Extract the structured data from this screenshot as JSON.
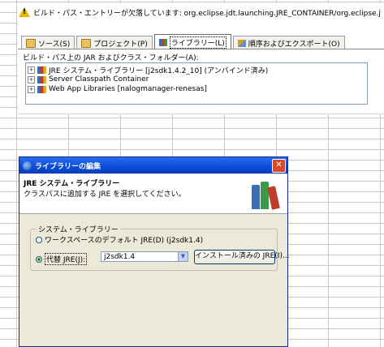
{
  "build_path_panel": {
    "warning": "ビルド・パス・エントリーが欠落しています: org.eclipse.jdt.launching.JRE_CONTAINER/org.eclipse.j",
    "tabs": [
      {
        "label": "ソース(S)",
        "icon": "folder-icon"
      },
      {
        "label": "プロジェクト(P)",
        "icon": "folder-icon"
      },
      {
        "label": "ライブラリー(L)",
        "icon": "library-icon",
        "active": true
      },
      {
        "label": "順序およびエクスポート(O)",
        "icon": "order-export-icon"
      }
    ],
    "path_label": "ビルド・パス上の JAR およびクラス・フォルダー(A):",
    "tree_items": [
      {
        "expander": "+",
        "label": "JRE システム・ライブラリー [j2sdk1.4.2_10] (アンバインド済み)"
      },
      {
        "expander": "+",
        "label": "Server Classpath Container"
      },
      {
        "expander": "+",
        "label": "Web App Libraries [nalogmanager-renesas]"
      }
    ]
  },
  "dialog": {
    "title": "ライブラリーの編集",
    "close_symbol": "✕",
    "header_title": "JRE システム・ライブラリー",
    "header_desc": "クラスパスに追加する JRE を選択してください。",
    "group_label": "システム・ライブラリー",
    "radio_workspace": "ワークスペースのデフォルト JRE(D) (j2sdk1.4)",
    "radio_alternate": "代替 JRE(J):",
    "jre_combo_value": "j2sdk1.4",
    "installed_jres_button": "インストール済みの JRE(I)..."
  },
  "colors": {
    "titlebar": "#0b4ad8",
    "dialog_bg": "#ece9d8",
    "warning": "#e8b400"
  }
}
